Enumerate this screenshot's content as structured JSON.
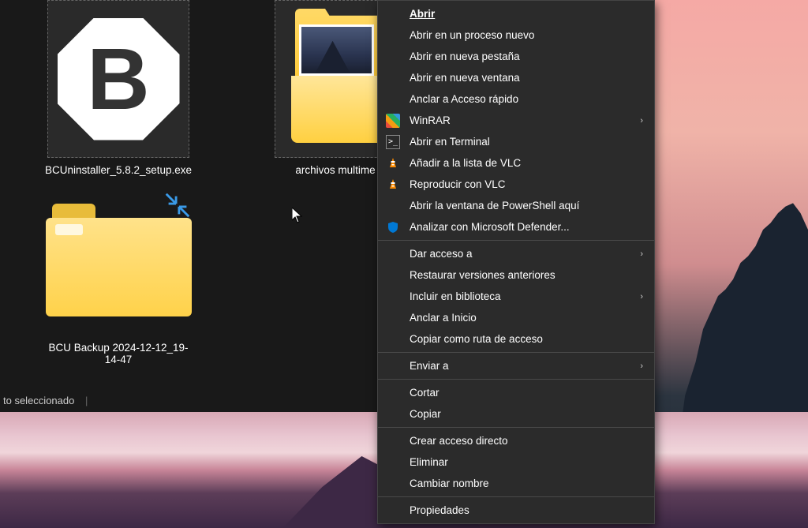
{
  "desktop": {
    "items": [
      {
        "label": "BCUninstaller_5.8.2_setup.exe"
      },
      {
        "label": "archivos multime"
      },
      {
        "label": "BCU Backup 2024-12-12_19-14-47"
      }
    ]
  },
  "status": {
    "text": "to seleccionado"
  },
  "context_menu": {
    "items": [
      {
        "label": "Abrir",
        "bold": true,
        "icon": null,
        "submenu": false,
        "underline_pos": 0
      },
      {
        "label": "Abrir en un proceso nuevo",
        "icon": null,
        "submenu": false
      },
      {
        "label": "Abrir en nueva pestaña",
        "icon": null,
        "submenu": false
      },
      {
        "label": "Abrir en nueva ventana",
        "icon": null,
        "submenu": false
      },
      {
        "label": "Anclar a Acceso rápido",
        "icon": null,
        "submenu": false
      },
      {
        "label": "WinRAR",
        "icon": "winrar",
        "submenu": true
      },
      {
        "label": "Abrir en Terminal",
        "icon": "terminal",
        "submenu": false
      },
      {
        "label": "Añadir a la lista de VLC",
        "icon": "vlc",
        "submenu": false
      },
      {
        "label": "Reproducir con VLC",
        "icon": "vlc",
        "submenu": false
      },
      {
        "label": "Abrir la ventana de PowerShell aquí",
        "icon": null,
        "submenu": false
      },
      {
        "label": "Analizar con Microsoft Defender...",
        "icon": "defender",
        "submenu": false
      },
      {
        "separator": true
      },
      {
        "label": "Dar acceso a",
        "icon": null,
        "submenu": true
      },
      {
        "label": "Restaurar versiones anteriores",
        "icon": null,
        "submenu": false
      },
      {
        "label": "Incluir en biblioteca",
        "icon": null,
        "submenu": true
      },
      {
        "label": "Anclar a Inicio",
        "icon": null,
        "submenu": false
      },
      {
        "label": "Copiar como ruta de acceso",
        "icon": null,
        "submenu": false
      },
      {
        "separator": true
      },
      {
        "label": "Enviar a",
        "icon": null,
        "submenu": true
      },
      {
        "separator": true
      },
      {
        "label": "Cortar",
        "icon": null,
        "submenu": false
      },
      {
        "label": "Copiar",
        "icon": null,
        "submenu": false
      },
      {
        "separator": true
      },
      {
        "label": "Crear acceso directo",
        "icon": null,
        "submenu": false
      },
      {
        "label": "Eliminar",
        "icon": null,
        "submenu": false
      },
      {
        "label": "Cambiar nombre",
        "icon": null,
        "submenu": false
      },
      {
        "separator": true
      },
      {
        "label": "Propiedades",
        "icon": null,
        "submenu": false
      }
    ]
  }
}
